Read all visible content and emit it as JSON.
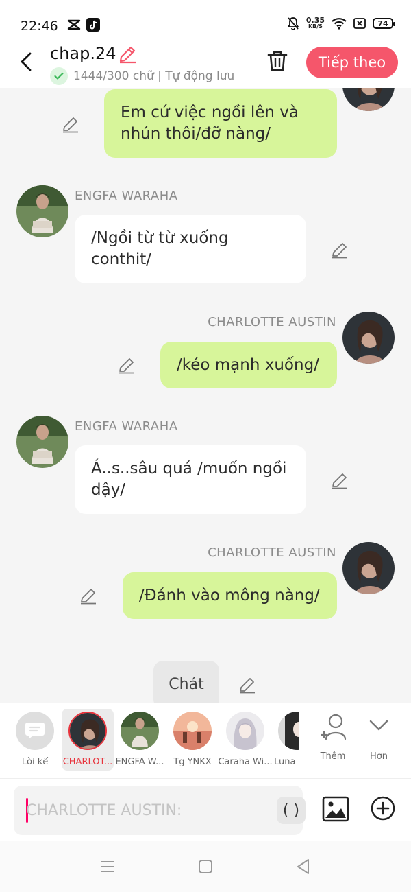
{
  "status_bar": {
    "time": "22:46",
    "net_speed_value": "0.35",
    "net_speed_unit": "KB/S",
    "battery": "74"
  },
  "header": {
    "title": "chap.24",
    "save_status": "1444/300 chữ | Tự động lưu",
    "next_label": "Tiếp theo",
    "accent_color": "#f5566b"
  },
  "messages": [
    {
      "speaker": "",
      "side": "right",
      "text": "Em cứ việc ngồi lên và nhún thôi/đỡ nàng/"
    },
    {
      "speaker": "ENGFA WARAHA",
      "side": "left",
      "text": "/Ngồi từ từ xuống conthit/"
    },
    {
      "speaker": "CHARLOTTE AUSTIN",
      "side": "right",
      "text": "/kéo mạnh xuống/"
    },
    {
      "speaker": "ENGFA WARAHA",
      "side": "left",
      "text": "Á..s..sâu quá /muốn ngồi dậy/"
    },
    {
      "speaker": "CHARLOTTE AUSTIN",
      "side": "right",
      "text": "/Đánh vào mông nàng/"
    }
  ],
  "narration": {
    "text": "Chát"
  },
  "characters": [
    {
      "name": "Lời kể",
      "icon": "narration-icon"
    },
    {
      "name": "CHARLOT...",
      "selected": true
    },
    {
      "name": "ENGFA W..."
    },
    {
      "name": "Tg YNKX"
    },
    {
      "name": "Caraha Wi..."
    },
    {
      "name": "Luna"
    }
  ],
  "actions": {
    "add_label": "Thêm",
    "more_label": "Hơn"
  },
  "input": {
    "placeholder": "CHARLOTTE AUSTIN:",
    "paren_label": "( )"
  },
  "colors": {
    "bubble_right": "#d7f59a",
    "bubble_left": "#ffffff",
    "selected_name": "#e8333c"
  }
}
